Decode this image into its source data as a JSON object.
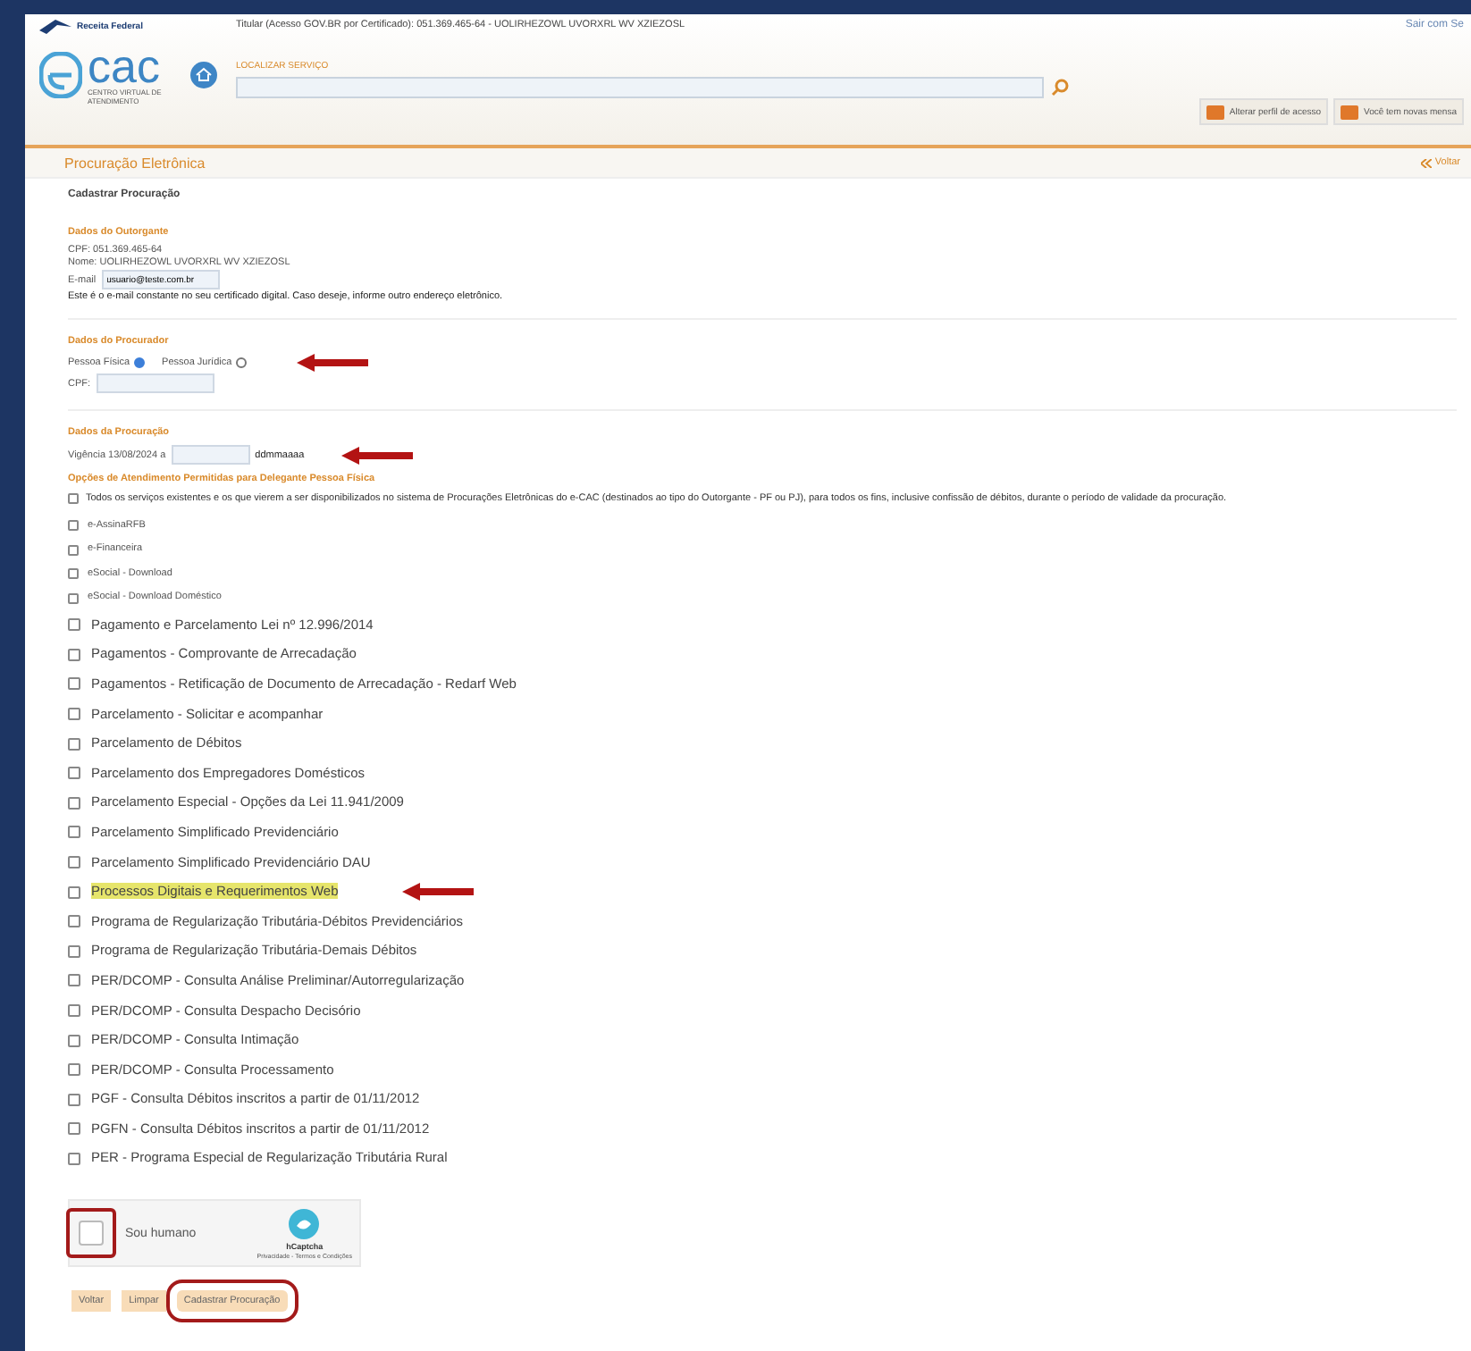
{
  "header": {
    "brand": "Receita Federal",
    "holder": "Titular (Acesso GOV.BR por Certificado): 051.369.465-64 - UOLIRHEZOWL UVORXRL WV XZIEZOSL",
    "logout": "Sair com Se",
    "logo_text": "cac",
    "logo_sub": "CENTRO VIRTUAL DE ATENDIMENTO",
    "search_label": "LOCALIZAR SERVIÇO",
    "actions": [
      "Alterar perfil de acesso",
      "Você tem novas mensa"
    ]
  },
  "page_title": "Procuração Eletrônica",
  "back_link": "Voltar",
  "form_title": "Cadastrar Procuração",
  "outorgante": {
    "heading": "Dados do Outorgante",
    "cpf": "CPF: 051.369.465-64",
    "name": "Nome: UOLIRHEZOWL UVORXRL WV XZIEZOSL",
    "email_label": "E-mail",
    "email_value": "usuario@teste.com.br",
    "note": "Este é o e-mail constante no seu certificado digital. Caso deseje, informe outro endereço eletrônico."
  },
  "procurador": {
    "heading": "Dados do Procurador",
    "annotated": true,
    "options": [
      {
        "label": "Pessoa Física",
        "selected": true
      },
      {
        "label": "Pessoa Jurídica",
        "selected": false
      }
    ],
    "cpf_label": "CPF:"
  },
  "procuracao": {
    "heading": "Dados da Procuração",
    "vigencia": "Vigência 13/08/2024 a",
    "date_hint": "ddmmaaaa",
    "annotated": true,
    "options_heading": "Opções de Atendimento Permitidas para Delegante Pessoa Física",
    "all_services": {
      "label": "Todos os serviços existentes e os que vierem a ser disponibilizados no sistema de Procurações Eletrônicas do e-CAC (destinados ao tipo do Outorgante - PF ou PJ), para todos os fins, inclusive confissão de débitos, durante o período de validade da procuração.",
      "checked": false
    }
  },
  "services": [
    {
      "label": "e-AssinaRFB",
      "checked": false,
      "kind": "small",
      "highlighted": false,
      "annotated": false
    },
    {
      "label": "e-Financeira",
      "checked": false,
      "kind": "small",
      "highlighted": false,
      "annotated": false
    },
    {
      "label": "eSocial - Download",
      "checked": false,
      "kind": "small",
      "highlighted": false,
      "annotated": false
    },
    {
      "label": "eSocial - Download Doméstico",
      "checked": false,
      "kind": "small",
      "highlighted": false,
      "annotated": false
    },
    {
      "label": "Pagamento e Parcelamento Lei nº 12.996/2014",
      "checked": false,
      "kind": "large",
      "highlighted": false,
      "annotated": false
    },
    {
      "label": "Pagamentos - Comprovante de Arrecadação",
      "checked": false,
      "kind": "large",
      "highlighted": false,
      "annotated": false
    },
    {
      "label": "Pagamentos - Retificação de Documento de Arrecadação - Redarf Web",
      "checked": false,
      "kind": "large",
      "highlighted": false,
      "annotated": false
    },
    {
      "label": "Parcelamento - Solicitar e acompanhar",
      "checked": false,
      "kind": "large",
      "highlighted": false,
      "annotated": false
    },
    {
      "label": "Parcelamento de Débitos",
      "checked": false,
      "kind": "large",
      "highlighted": false,
      "annotated": false
    },
    {
      "label": "Parcelamento dos Empregadores Domésticos",
      "checked": false,
      "kind": "large",
      "highlighted": false,
      "annotated": false
    },
    {
      "label": "Parcelamento Especial - Opções da Lei 11.941/2009",
      "checked": false,
      "kind": "large",
      "highlighted": false,
      "annotated": false
    },
    {
      "label": "Parcelamento Simplificado Previdenciário",
      "checked": false,
      "kind": "large",
      "highlighted": false,
      "annotated": false
    },
    {
      "label": "Parcelamento Simplificado Previdenciário DAU",
      "checked": false,
      "kind": "large",
      "highlighted": false,
      "annotated": false
    },
    {
      "label": "Processos Digitais e Requerimentos Web",
      "checked": false,
      "kind": "large",
      "highlighted": true,
      "annotated": true
    },
    {
      "label": "Programa de Regularização Tributária-Débitos Previdenciários",
      "checked": false,
      "kind": "large",
      "highlighted": false,
      "annotated": false
    },
    {
      "label": "Programa de Regularização Tributária-Demais Débitos",
      "checked": false,
      "kind": "large",
      "highlighted": false,
      "annotated": false
    },
    {
      "label": "PER/DCOMP - Consulta Análise Preliminar/Autorregularização",
      "checked": false,
      "kind": "large",
      "highlighted": false,
      "annotated": false
    },
    {
      "label": "PER/DCOMP - Consulta Despacho Decisório",
      "checked": false,
      "kind": "large",
      "highlighted": false,
      "annotated": false
    },
    {
      "label": "PER/DCOMP - Consulta Intimação",
      "checked": false,
      "kind": "large",
      "highlighted": false,
      "annotated": false
    },
    {
      "label": "PER/DCOMP - Consulta Processamento",
      "checked": false,
      "kind": "large",
      "highlighted": false,
      "annotated": false
    },
    {
      "label": "PGF - Consulta Débitos inscritos a partir de 01/11/2012",
      "checked": false,
      "kind": "large",
      "highlighted": false,
      "annotated": false
    },
    {
      "label": "PGFN - Consulta Débitos inscritos a partir de 01/11/2012",
      "checked": false,
      "kind": "large",
      "highlighted": false,
      "annotated": false
    },
    {
      "label": "PER - Programa Especial de Regularização Tributária Rural",
      "checked": false,
      "kind": "large",
      "highlighted": false,
      "annotated": false
    }
  ],
  "captcha": {
    "label": "Sou humano",
    "checked": false,
    "outlined": true,
    "brand": "hCaptcha",
    "links": "Privacidade - Termos e Condições"
  },
  "buttons": [
    {
      "label": "Voltar",
      "outlined": false
    },
    {
      "label": "Limpar",
      "outlined": false
    },
    {
      "label": "Cadastrar Procuração",
      "outlined": true
    }
  ]
}
